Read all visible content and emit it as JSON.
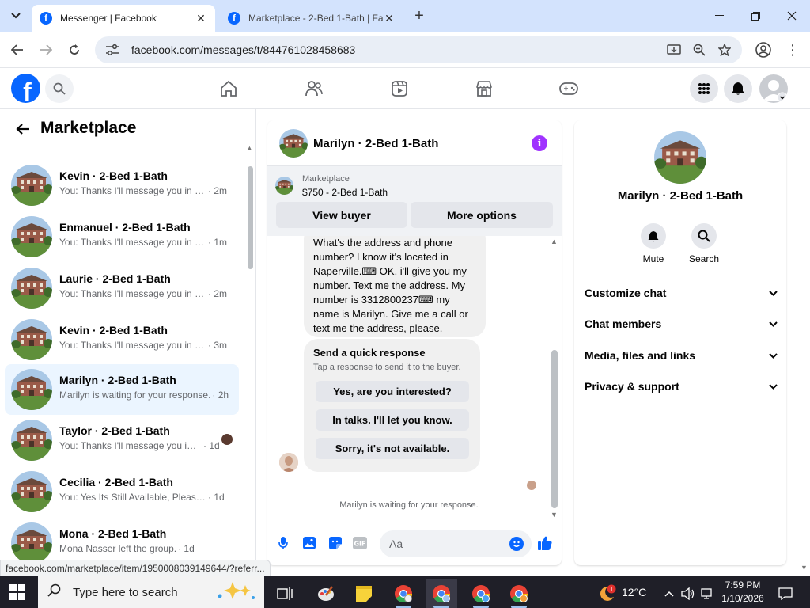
{
  "browser": {
    "tabs": [
      {
        "title": "Messenger | Facebook",
        "active": true
      },
      {
        "title": "Marketplace - 2-Bed 1-Bath | Fa",
        "active": false
      }
    ],
    "url": "facebook.com/messages/t/844761028458683",
    "status_url": "facebook.com/marketplace/item/1950008039149644/?referr..."
  },
  "left": {
    "title": "Marketplace",
    "conversations": [
      {
        "name": "Kevin · 2-Bed 1-Bath",
        "preview": "You: Thanks I'll message you in a ...",
        "time": "· 2m",
        "selected": false
      },
      {
        "name": "Enmanuel · 2-Bed 1-Bath",
        "preview": "You: Thanks I'll message you in a ...",
        "time": "· 1m",
        "selected": false
      },
      {
        "name": "Laurie · 2-Bed 1-Bath",
        "preview": "You: Thanks I'll message you in a ...",
        "time": "· 2m",
        "selected": false
      },
      {
        "name": "Kevin · 2-Bed 1-Bath",
        "preview": "You: Thanks I'll message you in a ...",
        "time": "· 3m",
        "selected": false
      },
      {
        "name": "Marilyn · 2-Bed 1-Bath",
        "preview": "Marilyn is waiting for your response.",
        "time": "· 2h",
        "selected": true
      },
      {
        "name": "Taylor · 2-Bed 1-Bath",
        "preview": "You: Thanks I'll message you in ...",
        "time": "· 1d",
        "selected": false
      },
      {
        "name": "Cecilia · 2-Bed 1-Bath",
        "preview": "You: Yes Its Still Available, Please Se...",
        "time": "· 1d",
        "selected": false
      },
      {
        "name": "Mona · 2-Bed 1-Bath",
        "preview": "Mona Nasser left the group.",
        "time": "· 1d",
        "selected": false
      }
    ]
  },
  "chat": {
    "name": "Marilyn · 2-Bed 1-Bath",
    "listing_source": "Marketplace",
    "listing_price": "$750 - 2-Bed 1-Bath",
    "view_buyer": "View buyer",
    "more_options": "More options",
    "message": "What's the address and phone number? I know it's located in Naperville.⌨ OK. i'll give you my number. Text me the address. My number is 3312800237⌨ my name is Marilyn. Give me a call or text me the address, please.",
    "quick_title": "Send a quick response",
    "quick_sub": "Tap a response to send it to the buyer.",
    "quick_replies": [
      "Yes, are you interested?",
      "In talks. I'll let you know.",
      "Sorry, it's not available."
    ],
    "waiting": "Marilyn is waiting for your response.",
    "input_placeholder": "Aa"
  },
  "details": {
    "name": "Marilyn · 2-Bed 1-Bath",
    "actions": [
      {
        "label": "Mute",
        "icon": "bell-icon"
      },
      {
        "label": "Search",
        "icon": "search-icon"
      }
    ],
    "sections": [
      "Customize chat",
      "Chat members",
      "Media, files and links",
      "Privacy & support"
    ]
  },
  "taskbar": {
    "search_placeholder": "Type here to search",
    "temperature": "12°C",
    "time": "7:59 PM",
    "date": "1/10/2026",
    "badge": "1"
  },
  "colors": {
    "facebook_blue": "#0866ff",
    "info_purple": "#a033ff",
    "selected_row": "#ebf5ff"
  }
}
